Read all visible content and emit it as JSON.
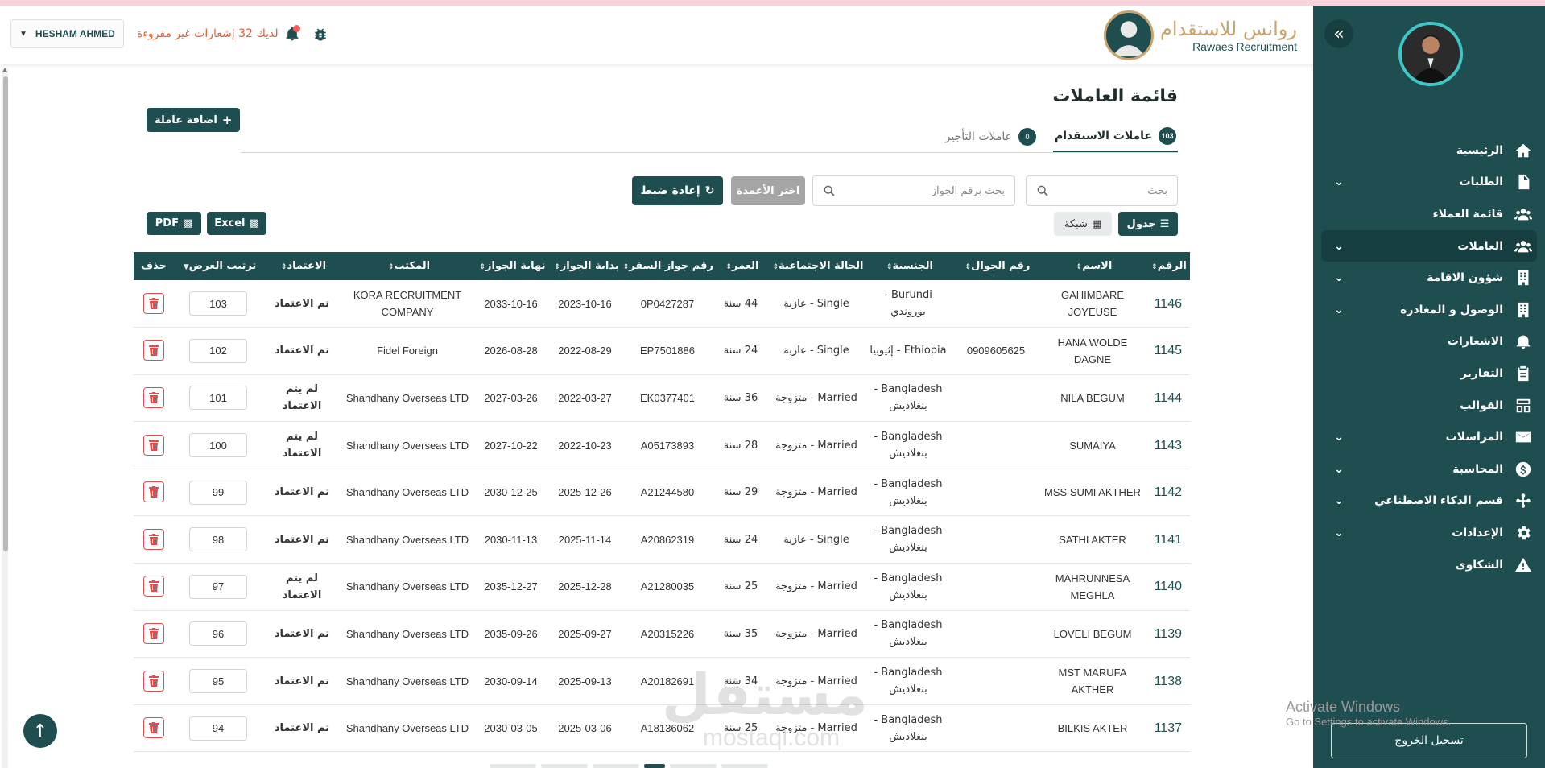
{
  "header": {
    "brand_ar": "روانس للاستقدام",
    "brand_en": "Rawaes Recruitment",
    "user_name": "HESHAM AHMED",
    "notifications_text": "لديك 32 إشعارات غير مقروءة"
  },
  "sidebar": {
    "items": [
      {
        "label": "الرئيسية",
        "icon": "home-icon",
        "has_chevron": false
      },
      {
        "label": "الطلبات",
        "icon": "document-icon",
        "has_chevron": true
      },
      {
        "label": "قائمة العملاء",
        "icon": "users-icon",
        "has_chevron": false
      },
      {
        "label": "العاملات",
        "icon": "users-icon",
        "has_chevron": true,
        "active": true
      },
      {
        "label": "شؤون الاقامة",
        "icon": "building-icon",
        "has_chevron": true
      },
      {
        "label": "الوصول و المغادرة",
        "icon": "building-icon",
        "has_chevron": true
      },
      {
        "label": "الاشعارات",
        "icon": "bell-icon",
        "has_chevron": false
      },
      {
        "label": "التقارير",
        "icon": "clipboard-icon",
        "has_chevron": false
      },
      {
        "label": "القوالب",
        "icon": "template-icon",
        "has_chevron": false
      },
      {
        "label": "المراسلات",
        "icon": "mail-icon",
        "has_chevron": true
      },
      {
        "label": "المحاسبة",
        "icon": "dollar-icon",
        "has_chevron": true
      },
      {
        "label": "قسم الذكاء الاصطناعي",
        "icon": "ai-icon",
        "has_chevron": true
      },
      {
        "label": "الإعدادات",
        "icon": "gear-icon",
        "has_chevron": true
      },
      {
        "label": "الشكاوى",
        "icon": "warning-icon",
        "has_chevron": false
      }
    ],
    "logout_label": "تسجيل الخروج"
  },
  "main": {
    "title": "قائمة العاملات",
    "add_button": "اضافة عاملة",
    "tabs": [
      {
        "label": "عاملات الاستقدام",
        "count": "103"
      },
      {
        "label": "عاملات التأجير",
        "count": "0"
      }
    ],
    "search_placeholder": "بحث",
    "passport_search_placeholder": "بحث برقم الجواز",
    "choose_columns": "اختر الأعمدة",
    "reset": "إعادة ضبط",
    "view_table": "جدول",
    "view_grid": "شبكة",
    "export_excel": "Excel",
    "export_pdf": "PDF"
  },
  "table": {
    "columns": [
      "الرقم",
      "الاسم",
      "رقم الجوال",
      "الجنسية",
      "الحالة الاجتماعية",
      "العمر",
      "رقم جواز السفر",
      "بداية الجواز",
      "نهاية الجواز",
      "المكتب",
      "الاعتماد",
      "ترتيب العرض",
      "حذف"
    ],
    "rows": [
      {
        "id": "1146",
        "name": "GAHIMBARE JOYEUSE",
        "phone": "",
        "nationality": "Burundi - بوروندي",
        "marital": "Single - عازبة",
        "age": "44 سنة",
        "passport": "0P0427287",
        "start": "2023-10-16",
        "end": "2033-10-16",
        "office": "KORA RECRUITMENT COMPANY",
        "approval": "تم الاعتماد",
        "approved": true,
        "order": "103"
      },
      {
        "id": "1145",
        "name": "HANA WOLDE DAGNE",
        "phone": "0909605625",
        "nationality": "Ethiopia - إثيوبيا",
        "marital": "Single - عازبة",
        "age": "24 سنة",
        "passport": "EP7501886",
        "start": "2022-08-29",
        "end": "2026-08-28",
        "office": "Fidel Foreign",
        "approval": "تم الاعتماد",
        "approved": true,
        "order": "102"
      },
      {
        "id": "1144",
        "name": "NILA BEGUM",
        "phone": "",
        "nationality": "Bangladesh - بنغلاديش",
        "marital": "Married - متزوجة",
        "age": "36 سنة",
        "passport": "EK0377401",
        "start": "2022-03-27",
        "end": "2027-03-26",
        "office": "Shandhany Overseas LTD",
        "approval": "لم يتم الاعتماد",
        "approved": false,
        "order": "101"
      },
      {
        "id": "1143",
        "name": "SUMAIYA",
        "phone": "",
        "nationality": "Bangladesh - بنغلاديش",
        "marital": "Married - متزوجة",
        "age": "28 سنة",
        "passport": "A05173893",
        "start": "2022-10-23",
        "end": "2027-10-22",
        "office": "Shandhany Overseas LTD",
        "approval": "لم يتم الاعتماد",
        "approved": false,
        "order": "100"
      },
      {
        "id": "1142",
        "name": "MSS SUMI AKTHER",
        "phone": "",
        "nationality": "Bangladesh - بنغلاديش",
        "marital": "Married - متزوجة",
        "age": "29 سنة",
        "passport": "A21244580",
        "start": "2025-12-26",
        "end": "2030-12-25",
        "office": "Shandhany Overseas LTD",
        "approval": "تم الاعتماد",
        "approved": true,
        "order": "99"
      },
      {
        "id": "1141",
        "name": "SATHI AKTER",
        "phone": "",
        "nationality": "Bangladesh - بنغلاديش",
        "marital": "Single - عازبة",
        "age": "24 سنة",
        "passport": "A20862319",
        "start": "2025-11-14",
        "end": "2030-11-13",
        "office": "Shandhany Overseas LTD",
        "approval": "تم الاعتماد",
        "approved": true,
        "order": "98"
      },
      {
        "id": "1140",
        "name": "MAHRUNNESA MEGHLA",
        "phone": "",
        "nationality": "Bangladesh - بنغلاديش",
        "marital": "Married - متزوجة",
        "age": "25 سنة",
        "passport": "A21280035",
        "start": "2025-12-28",
        "end": "2035-12-27",
        "office": "Shandhany Overseas LTD",
        "approval": "لم يتم الاعتماد",
        "approved": false,
        "order": "97"
      },
      {
        "id": "1139",
        "name": "LOVELI BEGUM",
        "phone": "",
        "nationality": "Bangladesh - بنغلاديش",
        "marital": "Married - متزوجة",
        "age": "35 سنة",
        "passport": "A20315226",
        "start": "2025-09-27",
        "end": "2035-09-26",
        "office": "Shandhany Overseas LTD",
        "approval": "تم الاعتماد",
        "approved": true,
        "order": "96"
      },
      {
        "id": "1138",
        "name": "MST MARUFA AKTHER",
        "phone": "",
        "nationality": "Bangladesh - بنغلاديش",
        "marital": "Married - متزوجة",
        "age": "34 سنة",
        "passport": "A20182691",
        "start": "2025-09-13",
        "end": "2030-09-14",
        "office": "Shandhany Overseas LTD",
        "approval": "تم الاعتماد",
        "approved": true,
        "order": "95"
      },
      {
        "id": "1137",
        "name": "BILKIS AKTER",
        "phone": "",
        "nationality": "Bangladesh - بنغلاديش",
        "marital": "Married - متزوجة",
        "age": "25 سنة",
        "passport": "A18136062",
        "start": "2025-03-06",
        "end": "2030-03-05",
        "office": "Shandhany Overseas LTD",
        "approval": "تم الاعتماد",
        "approved": true,
        "order": "94"
      }
    ]
  },
  "overlay": {
    "watermark_ar": "مستقل",
    "watermark_en": "mostaql.com",
    "activate_title": "Activate Windows",
    "activate_sub": "Go to Settings to activate Windows."
  },
  "colors": {
    "primary": "#1f4e51",
    "accent_gold": "#c9a36b",
    "approved": "#1c8a4a",
    "not_approved": "#d9261c"
  }
}
